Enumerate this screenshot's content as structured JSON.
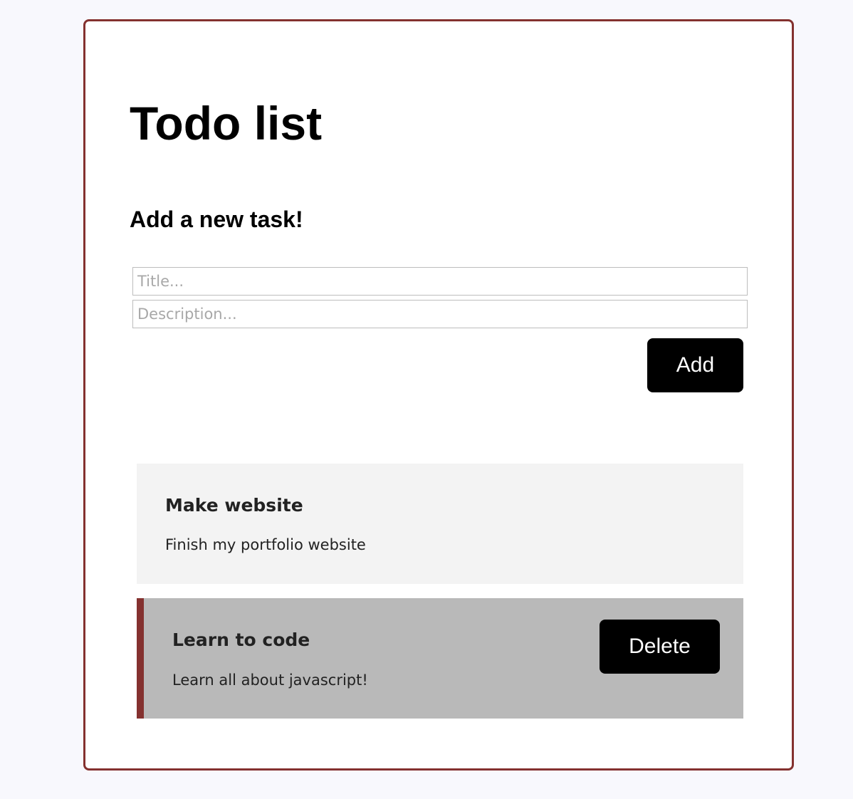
{
  "header": {
    "title": "Todo list"
  },
  "form": {
    "heading": "Add a new task!",
    "title_placeholder": "Title...",
    "title_value": "",
    "description_placeholder": "Description...",
    "description_value": "",
    "add_label": "Add"
  },
  "tasks": [
    {
      "title": "Make website",
      "description": "Finish my portfolio website",
      "hovered": false
    },
    {
      "title": "Learn to code",
      "description": "Learn all about javascript!",
      "hovered": true,
      "delete_label": "Delete"
    }
  ],
  "colors": {
    "accent": "#84312f",
    "background": "#f8f8fd",
    "task_bg": "#f3f3f3",
    "task_hover_bg": "#b9b9b9",
    "button_bg": "#000000"
  }
}
